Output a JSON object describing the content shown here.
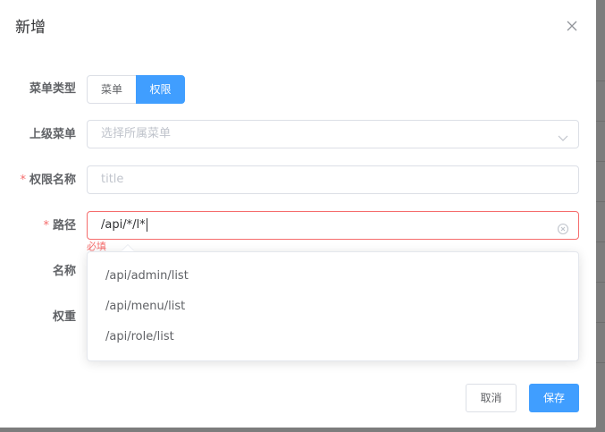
{
  "dialog": {
    "title": "新增",
    "close_icon": "close-icon"
  },
  "form": {
    "menu_type": {
      "label": "菜单类型",
      "options": [
        "菜单",
        "权限"
      ],
      "selected": "权限"
    },
    "parent_menu": {
      "label": "上级菜单",
      "placeholder": "选择所属菜单",
      "icon": "chevron-down-icon"
    },
    "permission_name": {
      "label": "权限名称",
      "required_mark": "*",
      "placeholder": "title"
    },
    "path": {
      "label": "路径",
      "required_mark": "*",
      "value": "/api/*/l*",
      "error": "必填",
      "icon": "clear-icon"
    },
    "name": {
      "label": "名称"
    },
    "weight": {
      "label": "权重"
    }
  },
  "autocomplete": {
    "items": [
      "/api/admin/list",
      "/api/menu/list",
      "/api/role/list"
    ]
  },
  "footer": {
    "cancel_label": "取消",
    "save_label": "保存"
  },
  "colors": {
    "primary": "#409eff",
    "danger": "#f56c6c",
    "overlay": "#8a8a8a"
  }
}
